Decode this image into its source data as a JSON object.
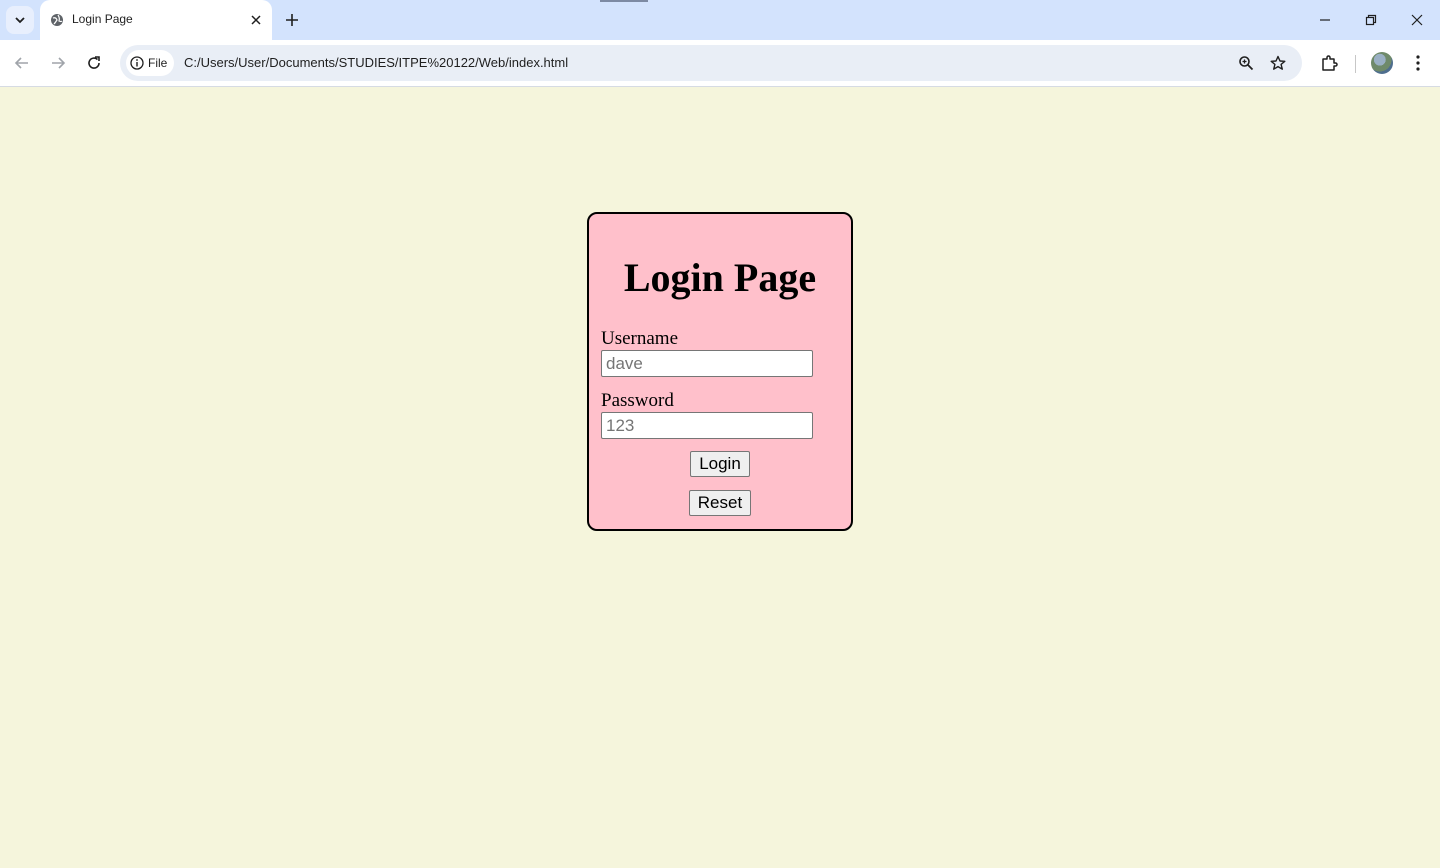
{
  "browser": {
    "tab_title": "Login Page",
    "url_chip_label": "File",
    "url": "C:/Users/User/Documents/STUDIES/ITPE%20122/Web/index.html"
  },
  "page": {
    "background_color": "#f5f5dc",
    "card_color": "#ffc0cb",
    "title": "Login Page",
    "username_label": "Username",
    "username_placeholder": "dave",
    "password_label": "Password",
    "password_placeholder": "123",
    "login_button": "Login",
    "reset_button": "Reset"
  },
  "icons": [
    "tab-search-icon",
    "globe-icon",
    "close-icon",
    "plus-icon",
    "minimize-icon",
    "restore-icon",
    "back-icon",
    "forward-icon",
    "reload-icon",
    "info-icon",
    "zoom-icon",
    "star-icon",
    "extensions-icon",
    "more-icon"
  ]
}
